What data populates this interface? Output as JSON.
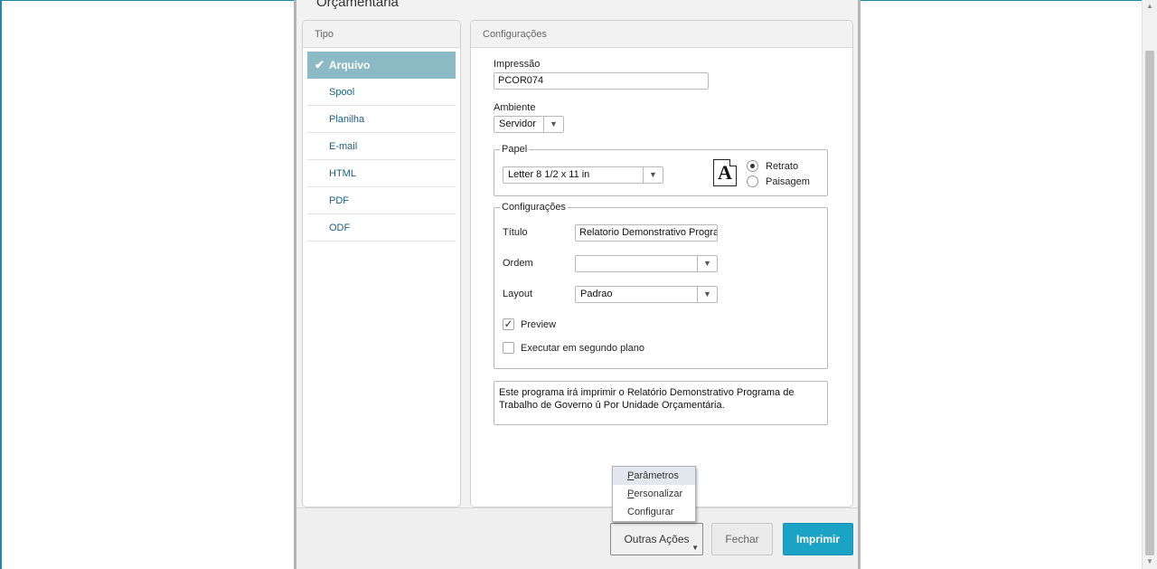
{
  "dialog": {
    "title": "Orçamentária"
  },
  "tipo": {
    "header": "Tipo",
    "items": [
      {
        "label": "Arquivo",
        "selected": true
      },
      {
        "label": "Spool",
        "selected": false
      },
      {
        "label": "Planilha",
        "selected": false
      },
      {
        "label": "E-mail",
        "selected": false
      },
      {
        "label": "HTML",
        "selected": false
      },
      {
        "label": "PDF",
        "selected": false
      },
      {
        "label": "ODF",
        "selected": false
      }
    ]
  },
  "config": {
    "header": "Configurações",
    "impressao_label": "Impressão",
    "impressao_value": "PCOR074",
    "ambiente_label": "Ambiente",
    "ambiente_value": "Servidor",
    "papel": {
      "legend": "Papel",
      "size_value": "Letter 8 1/2 x 11 in",
      "icon_letter": "A",
      "retrato_label": "Retrato",
      "paisagem_label": "Paisagem",
      "orientation": "Retrato"
    },
    "group": {
      "legend": "Configurações",
      "titulo_label": "Título",
      "titulo_value": "Relatorio Demonstrativo Progra",
      "ordem_label": "Ordem",
      "ordem_value": "",
      "layout_label": "Layout",
      "layout_value": "Padrao",
      "preview_label": "Preview",
      "preview_checked": true,
      "segundo_plano_label": "Executar em segundo plano",
      "segundo_plano_checked": false
    },
    "description_line1": "Este programa irá imprimir o Relatório Demonstrativo Programa de",
    "description_line2": "Trabalho de Governo û Por Unidade Orçamentária."
  },
  "menu": {
    "items": [
      {
        "first": "P",
        "rest": "arâmetros"
      },
      {
        "first": "P",
        "rest": "ersonalizar"
      },
      {
        "first": "",
        "rest": "Configurar"
      }
    ]
  },
  "footer": {
    "outras_acoes_label": "Outras Ações",
    "fechar_label": "Fechar",
    "imprimir_label": "Imprimir"
  },
  "colors": {
    "accent": "#1aa3c5",
    "selected_row": "#8bbac4",
    "link": "#1b5f8a"
  }
}
